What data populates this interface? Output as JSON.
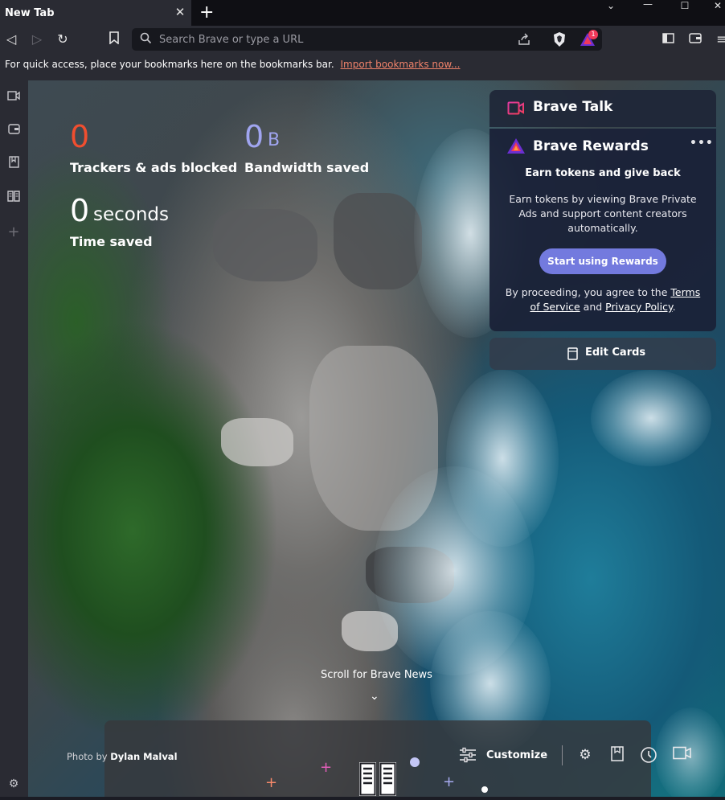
{
  "titlebar": {
    "tab_title": "New Tab",
    "tab_close_icon": "close-icon",
    "new_tab_icon": "plus-icon",
    "window_controls": [
      "chevron-down-icon",
      "minimize-icon",
      "maximize-icon",
      "close-icon"
    ]
  },
  "toolbar": {
    "search_placeholder": "Search Brave or type a URL",
    "rewards_badge": "1"
  },
  "bookmarks_bar": {
    "message": "For quick access, place your bookmarks here on the bookmarks bar.",
    "import_link": "Import bookmarks now..."
  },
  "stats": {
    "trackers_value": "0",
    "trackers_label": "Trackers & ads blocked",
    "bandwidth_value": "0",
    "bandwidth_unit": "B",
    "bandwidth_label": "Bandwidth saved",
    "time_value": "0",
    "time_unit": "seconds",
    "time_label": "Time saved"
  },
  "brave_talk": {
    "title": "Brave Talk"
  },
  "brave_rewards": {
    "title": "Brave Rewards",
    "more_icon": "•••",
    "heading": "Earn tokens and give back",
    "body": "Earn tokens by viewing Brave Private Ads and support content creators automatically.",
    "button": "Start using Rewards",
    "terms_prefix": "By proceeding, you agree to the",
    "terms_link": "Terms of Service",
    "terms_and": "and",
    "privacy_link": "Privacy Policy",
    "terms_suffix": "."
  },
  "edit_cards": {
    "label": "Edit Cards"
  },
  "footer": {
    "scroll_news": "Scroll for Brave News",
    "photo_by": "Photo by",
    "photographer": "Dylan Malval",
    "customize": "Customize"
  },
  "colors": {
    "trackers": "#f04e2f",
    "bandwidth": "#a0a5f0",
    "rewards_button": "#737ade",
    "import_link": "#f0826a"
  }
}
